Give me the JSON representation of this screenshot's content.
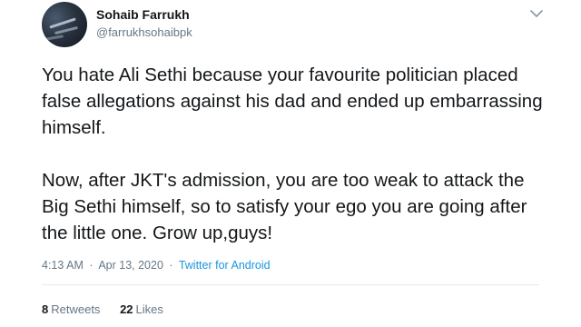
{
  "user": {
    "display_name": "Sohaib Farrukh",
    "handle": "@farrukhsohaibpk"
  },
  "tweet": {
    "paragraphs": [
      "You hate Ali Sethi because your favourite politician placed false allegations against his dad and ended up embarrassing himself.",
      "Now, after JKT's admission, you are too weak to attack the Big Sethi himself, so to satisfy your ego you are going after the little one. Grow up,guys!"
    ],
    "time": "4:13 AM",
    "separator": "·",
    "date": "Apr 13, 2020",
    "source": "Twitter for Android"
  },
  "stats": {
    "retweets_count": "8",
    "retweets_label": "Retweets",
    "likes_count": "22",
    "likes_label": "Likes"
  },
  "icons": {
    "menu": "chevron-down-icon"
  },
  "colors": {
    "link": "#1b95e0",
    "secondary_text": "#657786",
    "primary_text": "#14171a",
    "divider": "#e6ecf0"
  }
}
